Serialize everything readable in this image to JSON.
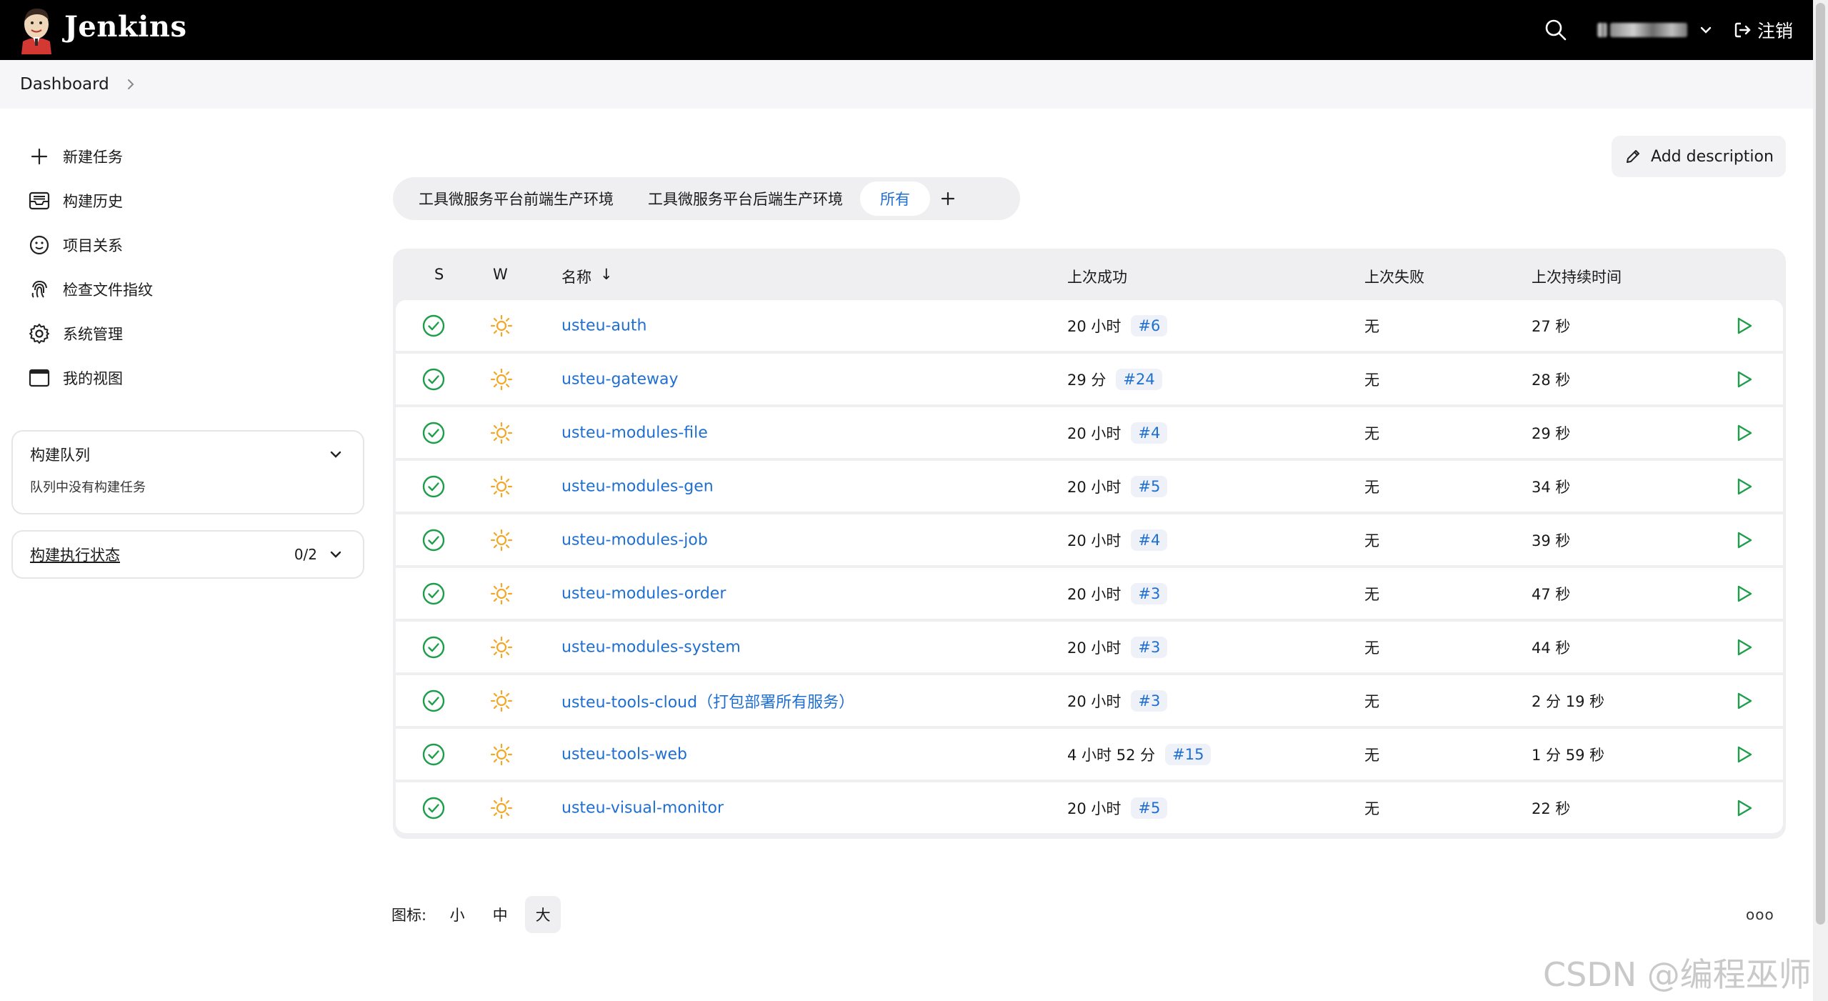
{
  "header": {
    "brand": "Jenkins",
    "logout_label": "注销"
  },
  "breadcrumb": {
    "item": "Dashboard"
  },
  "sidebar": {
    "tasks": [
      {
        "label": "新建任务",
        "icon": "plus-icon"
      },
      {
        "label": "构建历史",
        "icon": "inbox-icon"
      },
      {
        "label": "项目关系",
        "icon": "smiley-icon"
      },
      {
        "label": "检查文件指纹",
        "icon": "fingerprint-icon"
      },
      {
        "label": "系统管理",
        "icon": "gear-icon"
      },
      {
        "label": "我的视图",
        "icon": "window-icon"
      }
    ],
    "build_queue": {
      "title": "构建队列",
      "empty_text": "队列中没有构建任务"
    },
    "executor_status": {
      "title": "构建执行状态",
      "count": "0/2"
    }
  },
  "main": {
    "add_description": "Add description",
    "tabs": [
      {
        "label": "工具微服务平台前端生产环境",
        "active": false
      },
      {
        "label": "工具微服务平台后端生产环境",
        "active": false
      },
      {
        "label": "所有",
        "active": true
      }
    ],
    "table": {
      "headers": {
        "s": "S",
        "w": "W",
        "name": "名称",
        "name_sort": "↓",
        "last_success": "上次成功",
        "last_failure": "上次失败",
        "last_duration": "上次持续时间"
      },
      "rows": [
        {
          "name": "usteu-auth",
          "last_success": "20 小时",
          "build": "#6",
          "last_failure": "无",
          "duration": "27 秒"
        },
        {
          "name": "usteu-gateway",
          "last_success": "29 分",
          "build": "#24",
          "last_failure": "无",
          "duration": "28 秒"
        },
        {
          "name": "usteu-modules-file",
          "last_success": "20 小时",
          "build": "#4",
          "last_failure": "无",
          "duration": "29 秒"
        },
        {
          "name": "usteu-modules-gen",
          "last_success": "20 小时",
          "build": "#5",
          "last_failure": "无",
          "duration": "34 秒"
        },
        {
          "name": "usteu-modules-job",
          "last_success": "20 小时",
          "build": "#4",
          "last_failure": "无",
          "duration": "39 秒"
        },
        {
          "name": "usteu-modules-order",
          "last_success": "20 小时",
          "build": "#3",
          "last_failure": "无",
          "duration": "47 秒"
        },
        {
          "name": "usteu-modules-system",
          "last_success": "20 小时",
          "build": "#3",
          "last_failure": "无",
          "duration": "44 秒"
        },
        {
          "name": "usteu-tools-cloud（打包部署所有服务）",
          "last_success": "20 小时",
          "build": "#3",
          "last_failure": "无",
          "duration": "2 分 19 秒"
        },
        {
          "name": "usteu-tools-web",
          "last_success": "4 小时 52 分",
          "build": "#15",
          "last_failure": "无",
          "duration": "1 分 59 秒"
        },
        {
          "name": "usteu-visual-monitor",
          "last_success": "20 小时",
          "build": "#5",
          "last_failure": "无",
          "duration": "22 秒"
        }
      ]
    },
    "icon_size": {
      "label": "图标:",
      "options": [
        "小",
        "中",
        "大"
      ],
      "selected": "大"
    },
    "more": "ooo"
  },
  "watermark": "CSDN @编程巫师",
  "colors": {
    "link": "#1f6fd0",
    "success": "#1e9e4a",
    "sunny": "#f5a623",
    "header_bg": "#000000"
  }
}
